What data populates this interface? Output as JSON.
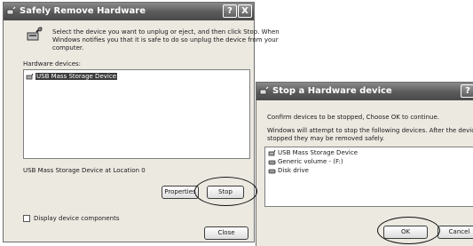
{
  "window1": {
    "title": "Safely Remove Hardware",
    "help_btn": "?",
    "close_btn": "X",
    "instructions": [
      "Select the device you want to unplug or eject, and then click Stop. When",
      "Windows notifies you that it is safe to do so unplug the device from your",
      "computer."
    ],
    "devices_label": "Hardware devices:",
    "devices": [
      "USB Mass Storage Device"
    ],
    "location_text": "USB Mass Storage Device at Location 0",
    "properties_button": "Properties",
    "stop_button": "Stop",
    "display_components_label": "Display device components",
    "close_button": "Close"
  },
  "window2": {
    "title": "Stop a Hardware device",
    "help_btn": "?",
    "confirm_text": "Confirm devices to be stopped, Choose OK to continue.",
    "warning_text": [
      "Windows will attempt to stop the following devices. After the devices are",
      "stopped they may be removed safely."
    ],
    "devices": [
      "USB Mass Storage Device",
      "Generic volume - (F:)",
      "Disk drive"
    ],
    "ok_button": "OK",
    "cancel_button": "Cancel"
  },
  "icons": {
    "title_icon": "safely-remove-hardware-icon",
    "device_icon": "usb-device-icon",
    "volume_icon": "drive-icon"
  }
}
